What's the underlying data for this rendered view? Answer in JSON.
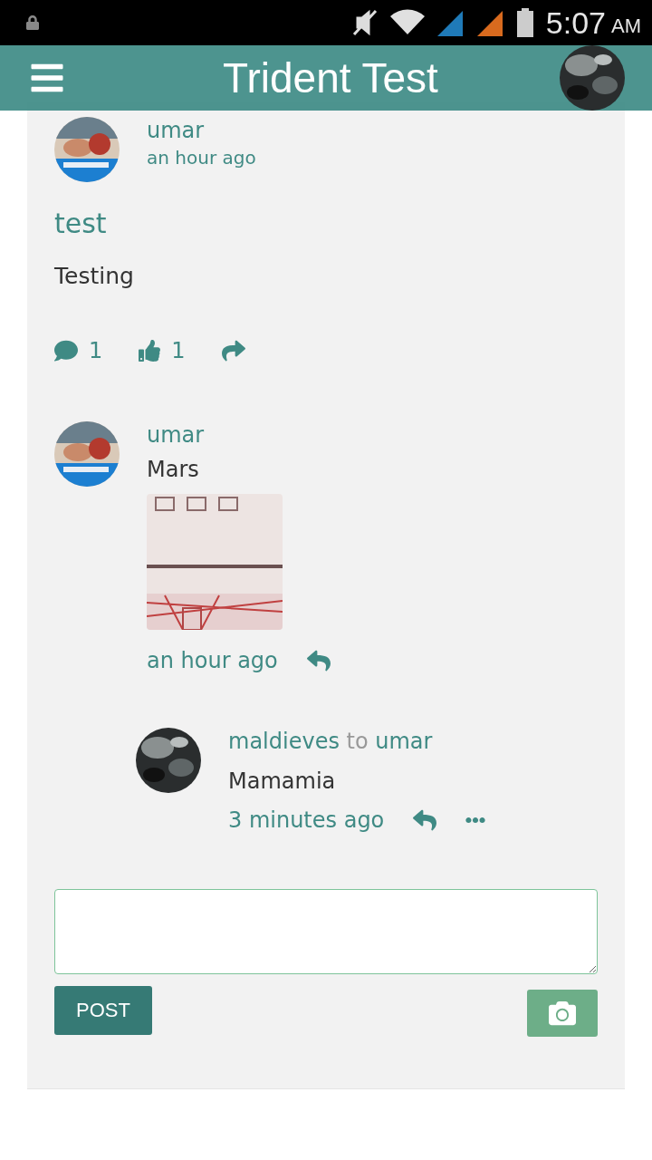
{
  "status_bar": {
    "time": "5:07",
    "meridiem": "AM"
  },
  "app_bar": {
    "title": "Trident Test"
  },
  "post": {
    "author": "umar",
    "time": "an hour ago",
    "title": "test",
    "body": "Testing",
    "comment_count": "1",
    "like_count": "1"
  },
  "comments": [
    {
      "author": "umar",
      "text": "Mars",
      "time": "an hour ago",
      "replies": [
        {
          "author": "maldieves",
          "connector": "to",
          "recipient": "umar",
          "text": "Mamamia",
          "time": "3 minutes ago"
        }
      ]
    }
  ],
  "composer": {
    "post_label": "POST"
  }
}
